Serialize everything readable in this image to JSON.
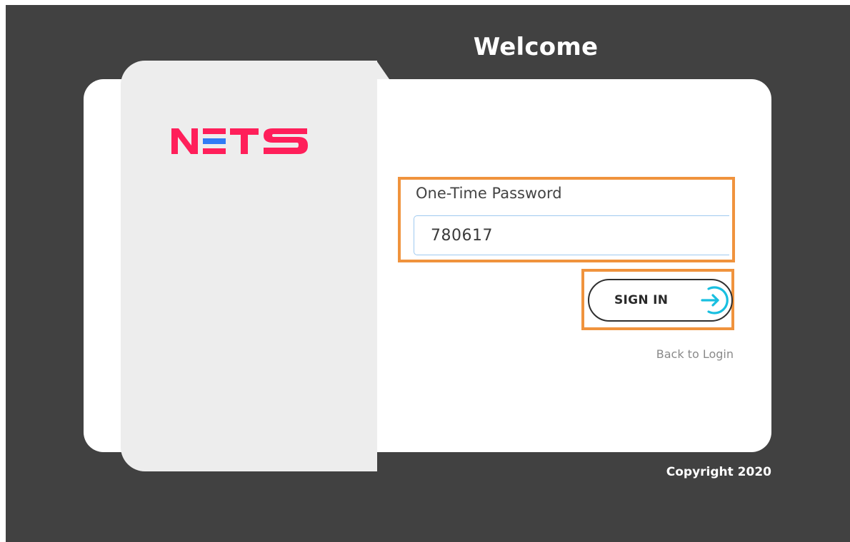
{
  "header": {
    "title": "Welcome"
  },
  "brand": {
    "logo_text": "NETS",
    "logo_colors": {
      "primary": "#ff1f5a",
      "accent": "#2f7cf6"
    }
  },
  "form": {
    "otp_label": "One-Time Password",
    "otp_value": "780617",
    "sign_in_label": "SIGN IN",
    "sign_in_icon": "sign-in-arrow-icon",
    "back_link": "Back to Login"
  },
  "footer": {
    "copyright": "Copyright 2020"
  },
  "colors": {
    "background": "#414141",
    "card": "#ffffff",
    "brand_panel": "#ededed",
    "highlight": "#f0933d",
    "icon_accent": "#18bfe0"
  }
}
